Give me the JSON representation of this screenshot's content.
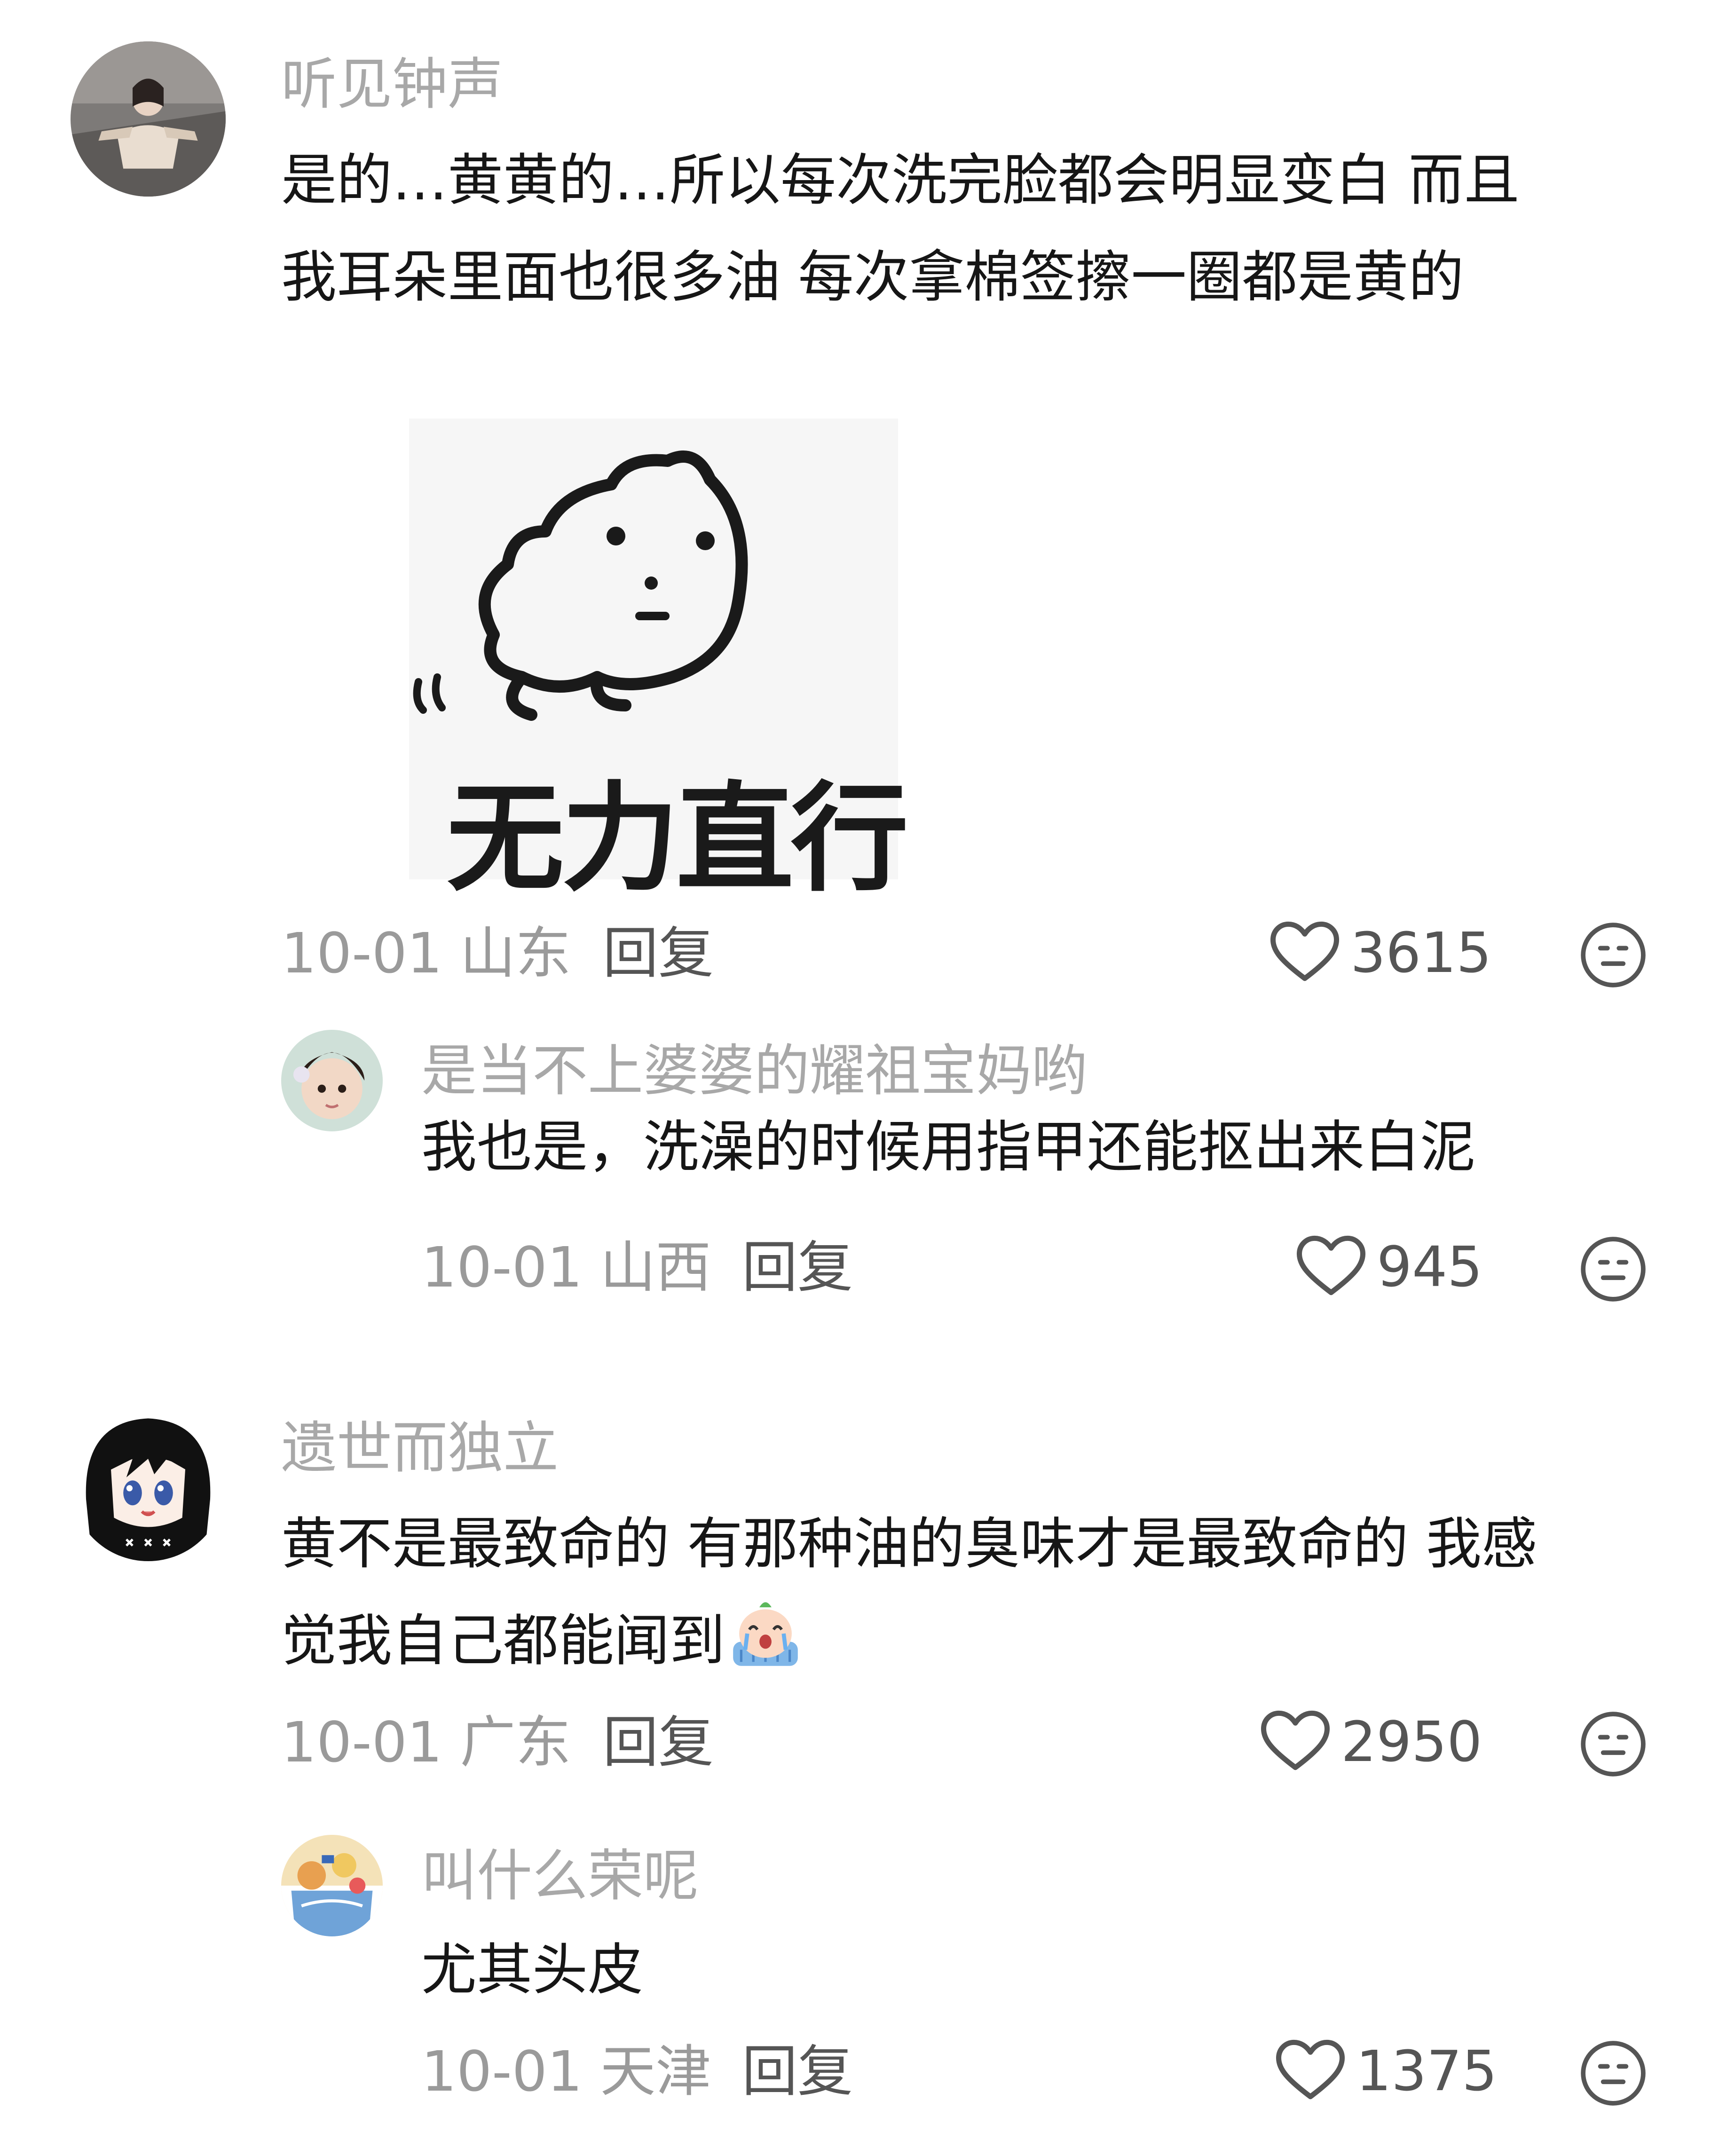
{
  "reply_label": "回复",
  "comments": [
    {
      "username": "听见钟声",
      "text_line1": "是的…黄黄的…所以每次洗完脸都会明显变白 而且",
      "text_line2": "我耳朵里面也很多油 每次拿棉签擦一圈都是黄的",
      "sticker_text": "无力直行",
      "date": "10-01",
      "location": "山东",
      "likes": "3615",
      "replies": [
        {
          "username": "是当不上婆婆的耀祖宝妈哟",
          "text": "我也是，洗澡的时候用指甲还能抠出来白泥",
          "date": "10-01",
          "location": "山西",
          "likes": "945"
        }
      ]
    },
    {
      "username": "遗世而独立",
      "text_line1": "黄不是最致命的 有那种油的臭味才是最致命的 我感",
      "text_line2": "觉我自己都能闻到",
      "inline_emoji": "crying-face-emoji",
      "date": "10-01",
      "location": "广东",
      "likes": "2950",
      "replies": [
        {
          "username": "叫什么荣呢",
          "text": "尤其头皮",
          "date": "10-01",
          "location": "天津",
          "likes": "1375"
        }
      ]
    }
  ],
  "icons": {
    "like": "heart-outline-icon",
    "dislike": "meh-face-icon"
  },
  "colors": {
    "username": "#a8a8a8",
    "text": "#161616",
    "meta": "#9a9a9a",
    "action": "#555555"
  }
}
